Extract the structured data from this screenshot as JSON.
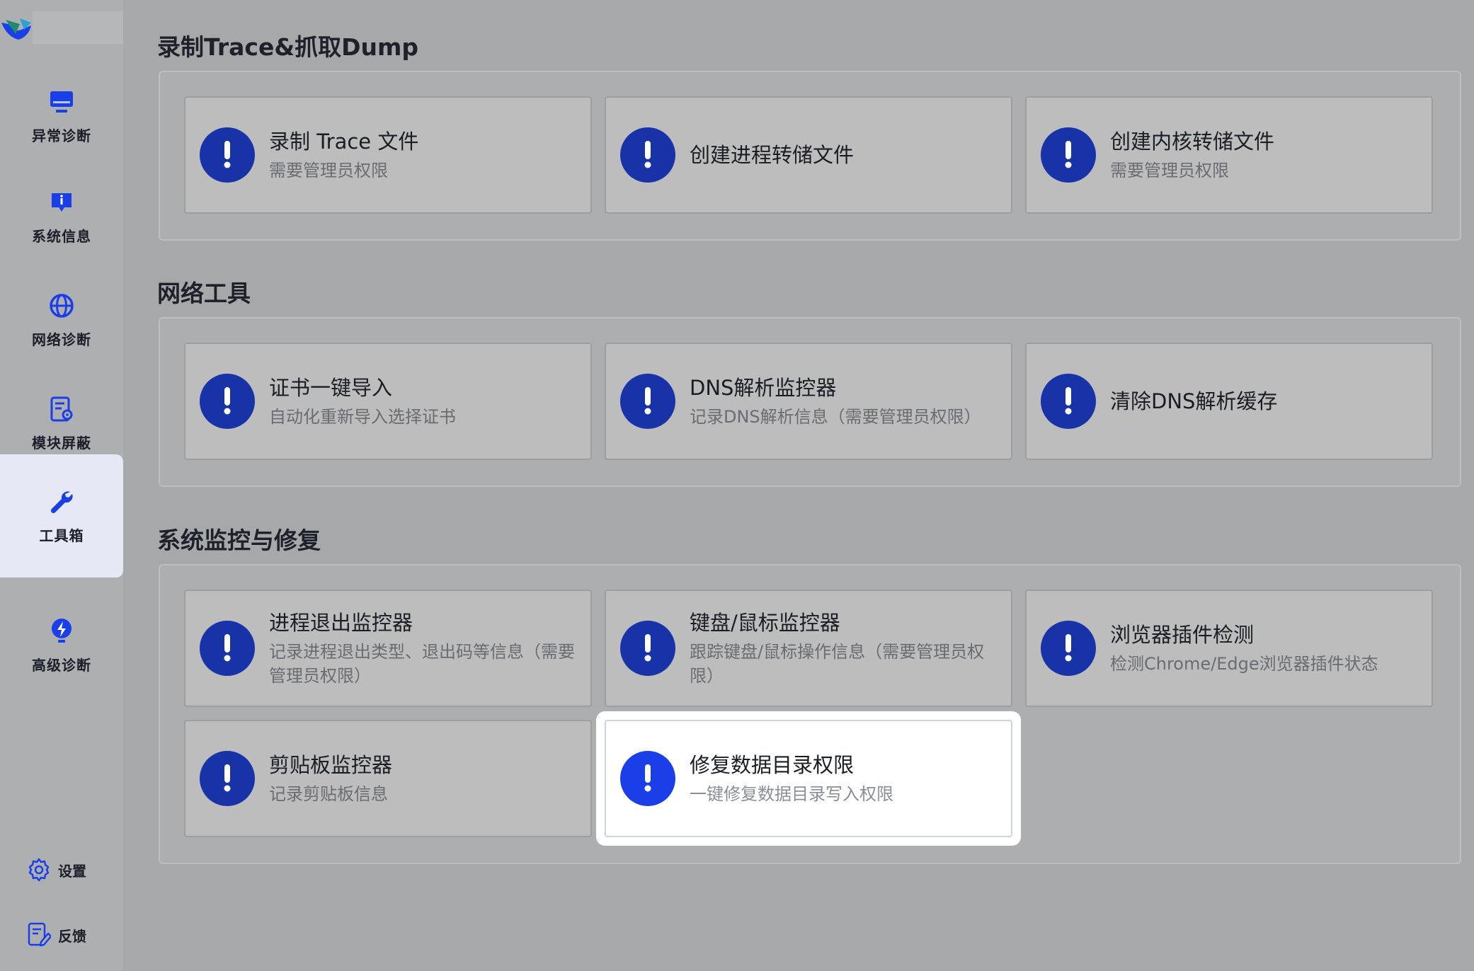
{
  "sidebar": {
    "items": [
      {
        "label": "异常诊断",
        "icon": "monitor-icon"
      },
      {
        "label": "系统信息",
        "icon": "info-icon"
      },
      {
        "label": "网络诊断",
        "icon": "globe-icon"
      },
      {
        "label": "模块屏蔽",
        "icon": "document-gear-icon"
      },
      {
        "label": "工具箱",
        "icon": "wrench-icon"
      },
      {
        "label": "高级诊断",
        "icon": "lightning-bulb-icon"
      }
    ],
    "settings_label": "设置",
    "feedback_label": "反馈"
  },
  "sections": [
    {
      "title": "录制Trace&抓取Dump",
      "cards": [
        {
          "title": "录制 Trace 文件",
          "subtitle": "需要管理员权限"
        },
        {
          "title": "创建进程转储文件",
          "subtitle": ""
        },
        {
          "title": "创建内核转储文件",
          "subtitle": "需要管理员权限"
        }
      ]
    },
    {
      "title": "网络工具",
      "cards": [
        {
          "title": "证书一键导入",
          "subtitle": "自动化重新导入选择证书"
        },
        {
          "title": "DNS解析监控器",
          "subtitle": "记录DNS解析信息（需要管理员权限）"
        },
        {
          "title": "清除DNS解析缓存",
          "subtitle": ""
        }
      ]
    },
    {
      "title": "系统监控与修复",
      "cards": [
        {
          "title": "进程退出监控器",
          "subtitle": "记录进程退出类型、退出码等信息（需要管理员权限）"
        },
        {
          "title": "键盘/鼠标监控器",
          "subtitle": "跟踪键盘/鼠标操作信息（需要管理员权限）"
        },
        {
          "title": "浏览器插件检测",
          "subtitle": "检测Chrome/Edge浏览器插件状态"
        },
        {
          "title": "剪贴板监控器",
          "subtitle": "记录剪贴板信息"
        },
        {
          "title": "修复数据目录权限",
          "subtitle": "一键修复数据目录写入权限"
        }
      ]
    }
  ],
  "colors": {
    "accent": "#1833a8",
    "accent_highlight": "#1a3fe8",
    "active_nav_bg": "#e6e8f5"
  }
}
